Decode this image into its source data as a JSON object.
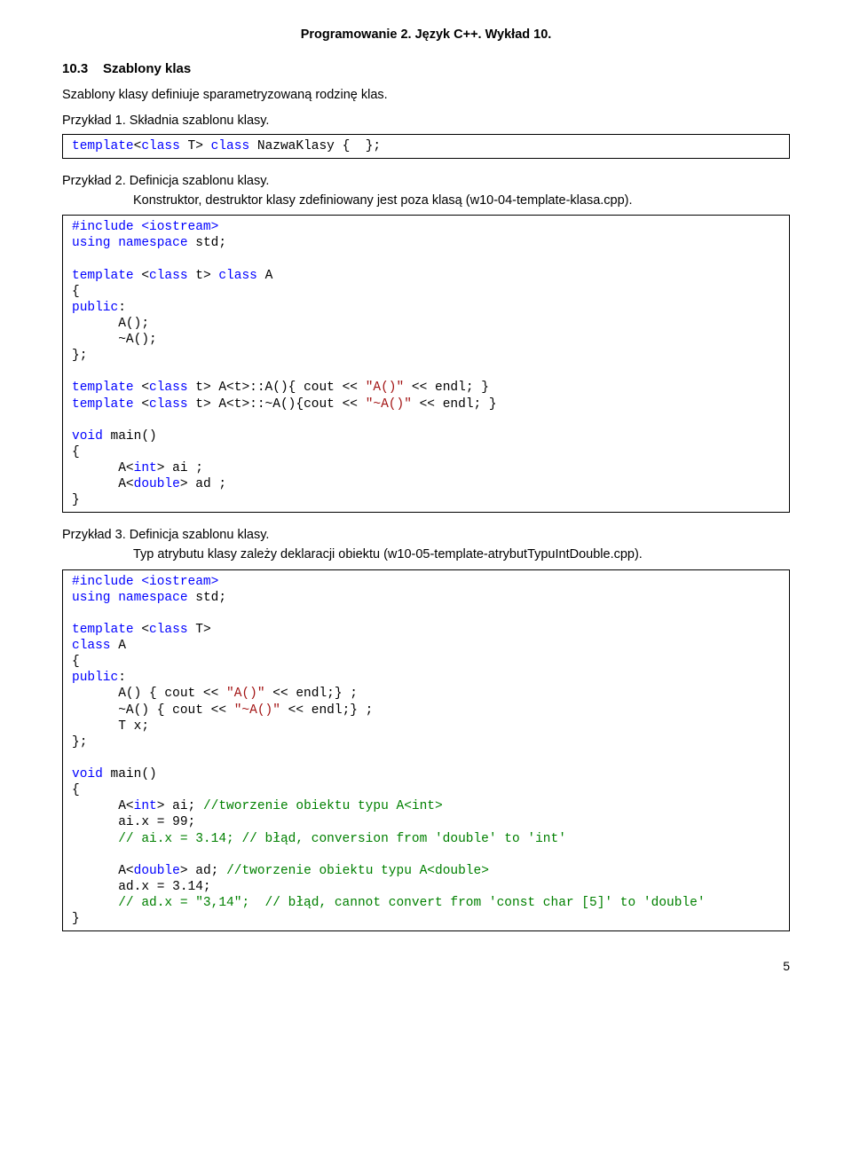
{
  "header": "Programowanie 2. Język C++. Wykład 10.",
  "section": {
    "num": "10.3",
    "title": "Szablony klas"
  },
  "intro": "Szablony klasy definiuje sparametryzowaną rodzinę klas.",
  "ex1": {
    "label": "Przykład 1. Składnia szablonu klasy."
  },
  "code1": {
    "l1a": "template",
    "l1b": "<",
    "l1c": "class",
    "l1d": " T> ",
    "l1e": "class",
    "l1f": " NazwaKlasy {  };"
  },
  "ex2": {
    "label": "Przykład 2. Definicja szablonu klasy.",
    "sub": "Konstruktor, destruktor klasy zdefiniowany jest poza klasą (w10-04-template-klasa.cpp)."
  },
  "code2": {
    "inc": "#include <iostream>",
    "using_a": "using",
    "using_b": " ",
    "using_c": "namespace",
    "using_d": " std;",
    "tpl1a": "template",
    "tpl1b": " <",
    "tpl1c": "class",
    "tpl1d": " t> ",
    "tpl1e": "class",
    "tpl1f": " A",
    "lb": "{",
    "rb_semi": "};",
    "pub": "public",
    "colon": ":",
    "l_ctor": "      A();",
    "l_dtor": "      ~A();",
    "impl1a": "template",
    "impl1b": " <",
    "impl1c": "class",
    "impl1d": " t> A<t>::A(){ cout << ",
    "impl1e": "\"A()\"",
    "impl1f": " << endl; }",
    "impl2a": "template",
    "impl2b": " <",
    "impl2c": "class",
    "impl2d": " t> A<t>::~A(){cout << ",
    "impl2e": "\"~A()\"",
    "impl2f": " << endl; }",
    "vmain_a": "void",
    "vmain_b": " main()",
    "m1": "      A<",
    "m1int": "int",
    "m1b": "> ai ;",
    "m2": "      A<",
    "m2dbl": "double",
    "m2b": "> ad ;",
    "rb": "}"
  },
  "ex3": {
    "label": "Przykład 3. Definicja szablonu klasy.",
    "sub": "Typ atrybutu klasy zależy deklaracji obiektu (w10-05-template-atrybutTypuIntDouble.cpp)."
  },
  "code3": {
    "inc": "#include <iostream>",
    "using_a": "using",
    "using_b": " ",
    "using_c": "namespace",
    "using_d": " std;",
    "tpl_a": "template",
    "tpl_b": " <",
    "tpl_c": "class",
    "tpl_d": " T>",
    "cls_a": "class",
    "cls_b": " A",
    "lb": "{",
    "rb": "}",
    "rb_semi": "};",
    "pub": "public",
    "colon": ":",
    "ctor_a": "      A() { cout << ",
    "ctor_b": "\"A()\"",
    "ctor_c": " << endl;} ;",
    "dtor_a": "      ~A() { cout << ",
    "dtor_b": "\"~A()\"",
    "dtor_c": " << endl;} ;",
    "tx": "      T x;",
    "vmain_a": "void",
    "vmain_b": " main()",
    "m1a": "      A<",
    "m1b": "int",
    "m1c": "> ai; ",
    "m1d": "//tworzenie obiektu typu A<int>",
    "m2": "      ai.x = 99;",
    "m3a": "      ",
    "m3b": "// ai.x = 3.14; // błąd, conversion from 'double' to 'int'",
    "m4a": "      A<",
    "m4b": "double",
    "m4c": "> ad; ",
    "m4d": "//tworzenie obiektu typu A<double>",
    "m5": "      ad.x = 3.14;",
    "m6a": "      ",
    "m6b": "// ad.x = \"3,14\";  // błąd, cannot convert from 'const char [5]' to 'double'"
  },
  "pagenum": "5"
}
